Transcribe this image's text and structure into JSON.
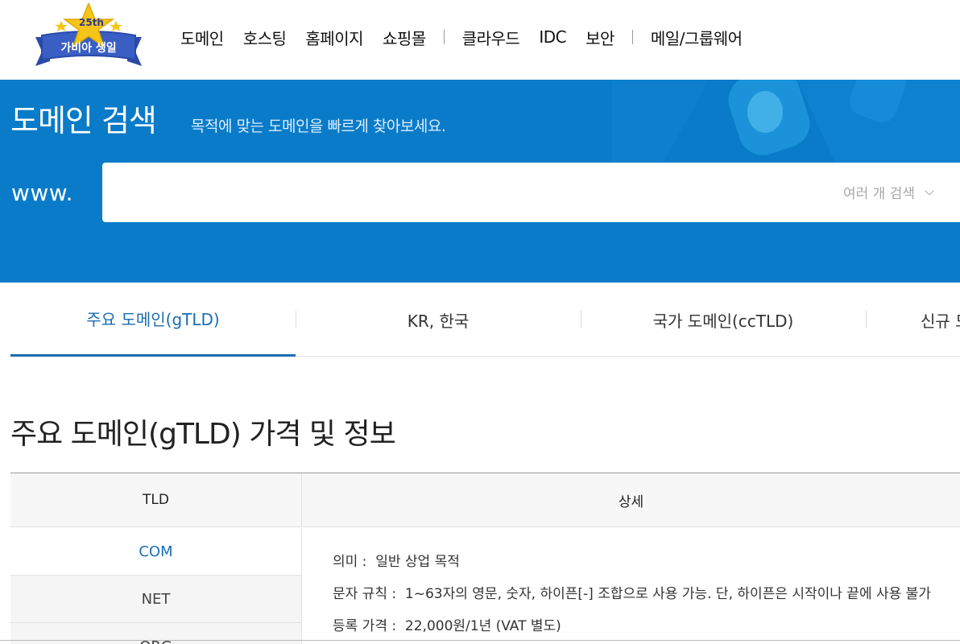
{
  "header": {
    "logo": {
      "badge": "25th",
      "text": "가비아 생일"
    },
    "nav": [
      "도메인",
      "호스팅",
      "홈페이지",
      "쇼핑몰",
      "클라우드",
      "IDC",
      "보안",
      "메일/그룹웨어"
    ]
  },
  "search": {
    "title": "도메인 검색",
    "subtitle": "목적에 맞는 도메인을 빠르게 찾아보세요.",
    "prefix": "www.",
    "input_value": "",
    "multi_search_label": "여러 개 검색"
  },
  "tabs": [
    "주요 도메인(gTLD)",
    "KR, 한국",
    "국가 도메인(ccTLD)",
    "신규 도메인"
  ],
  "active_tab": 0,
  "section": {
    "title": "주요 도메인(gTLD) 가격 및 정보"
  },
  "table": {
    "headers": {
      "tld": "TLD",
      "detail": "상세"
    },
    "tlds": [
      "COM",
      "NET",
      "ORG"
    ],
    "active_tld": 0,
    "detail": {
      "meaning_label": "의미 :",
      "meaning_value": "일반 상업 목적",
      "rule_label": "문자 규칙 :",
      "rule_value": "1~63자의 영문, 숫자, 하이픈[-] 조합으로 사용 가능. 단, 하이픈은 시작이나 끝에 사용 불가",
      "price_label": "등록 가격 :",
      "price_value": "22,000원/1년 (VAT 별도)"
    }
  },
  "colors": {
    "banner_bg": "#0a7bc8",
    "accent": "#1a6db3",
    "logo_star": "#f5c518",
    "logo_ribbon": "#3a5fc4"
  }
}
